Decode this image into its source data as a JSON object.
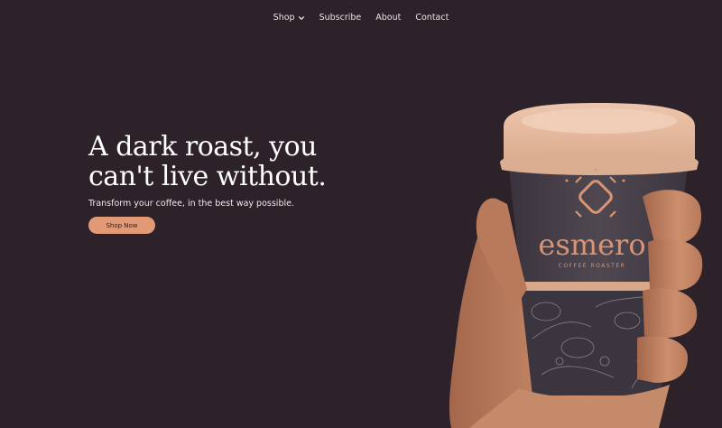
{
  "nav": {
    "items": [
      {
        "label": "Shop",
        "has_dropdown": true
      },
      {
        "label": "Subscribe"
      },
      {
        "label": "About"
      },
      {
        "label": "Contact"
      }
    ]
  },
  "hero": {
    "headline_line1": "A dark roast, you",
    "headline_line2": "can't live without.",
    "subtitle": "Transform your coffee, in the best way possible.",
    "cta_label": "Shop Now"
  },
  "product": {
    "brand": "esmero",
    "tagline": "COFFEE ROASTER"
  },
  "colors": {
    "background": "#2d2229",
    "accent": "#e29a76",
    "cup_lid": "#e3b9a0",
    "cup_sleeve": "#47404a",
    "skin": "#c88a6a"
  }
}
